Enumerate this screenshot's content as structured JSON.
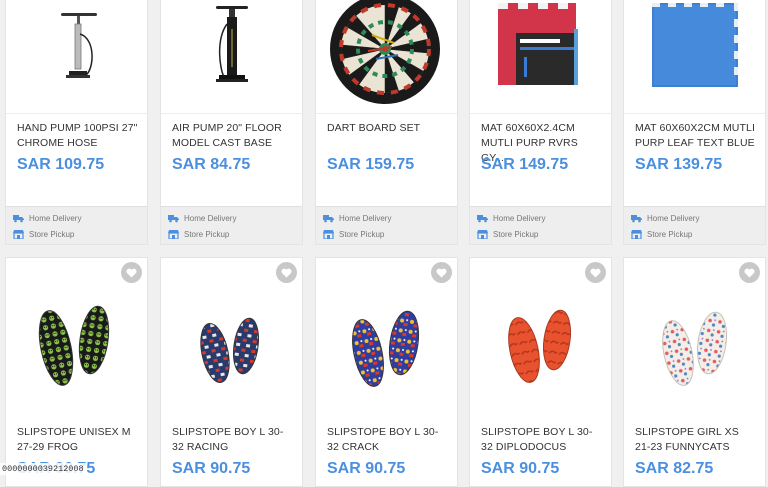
{
  "row1": [
    {
      "title": "HAND PUMP 100PSI 27\" CHROME HOSE",
      "price": "SAR 109.75",
      "image": "hand-pump-image"
    },
    {
      "title": "AIR PUMP 20\" FLOOR MODEL CAST BASE",
      "price": "SAR 84.75",
      "image": "floor-pump-image"
    },
    {
      "title": "DART BOARD SET",
      "price": "SAR 159.75",
      "image": "dart-board-image"
    },
    {
      "title": "MAT 60X60X2.4CM MUTLI PURP RVRS GY...",
      "price": "SAR 149.75",
      "image": "red-mat-image"
    },
    {
      "title": "MAT 60X60X2CM MUTLI PURP LEAF TEXT BLUE",
      "price": "SAR 139.75",
      "image": "blue-mat-image"
    }
  ],
  "row2": [
    {
      "title": "SLIPSTOPE UNISEX M 27-29 FROG",
      "price": "SAR 90.75",
      "pattern": "frog"
    },
    {
      "title": "SLIPSTOPE BOY L 30-32 RACING",
      "price": "SAR 90.75",
      "pattern": "racing"
    },
    {
      "title": "SLIPSTOPE BOY L 30-32 CRACK",
      "price": "SAR 90.75",
      "pattern": "crack"
    },
    {
      "title": "SLIPSTOPE BOY L 30-32 DIPLODOCUS",
      "price": "SAR 90.75",
      "pattern": "diplodocus"
    },
    {
      "title": "SLIPSTOPE GIRL XS 21-23 FUNNYCATS",
      "price": "SAR 82.75",
      "pattern": "funnycats"
    }
  ],
  "delivery": {
    "home_label": "Home Delivery",
    "pickup_label": "Store Pickup"
  },
  "overlay": {
    "barcode_text": "0000000039212008"
  },
  "colors": {
    "price": "#4b8fe0",
    "favorite_button": "#c8c8c8",
    "delivery_icon": "#4b8fe0"
  }
}
